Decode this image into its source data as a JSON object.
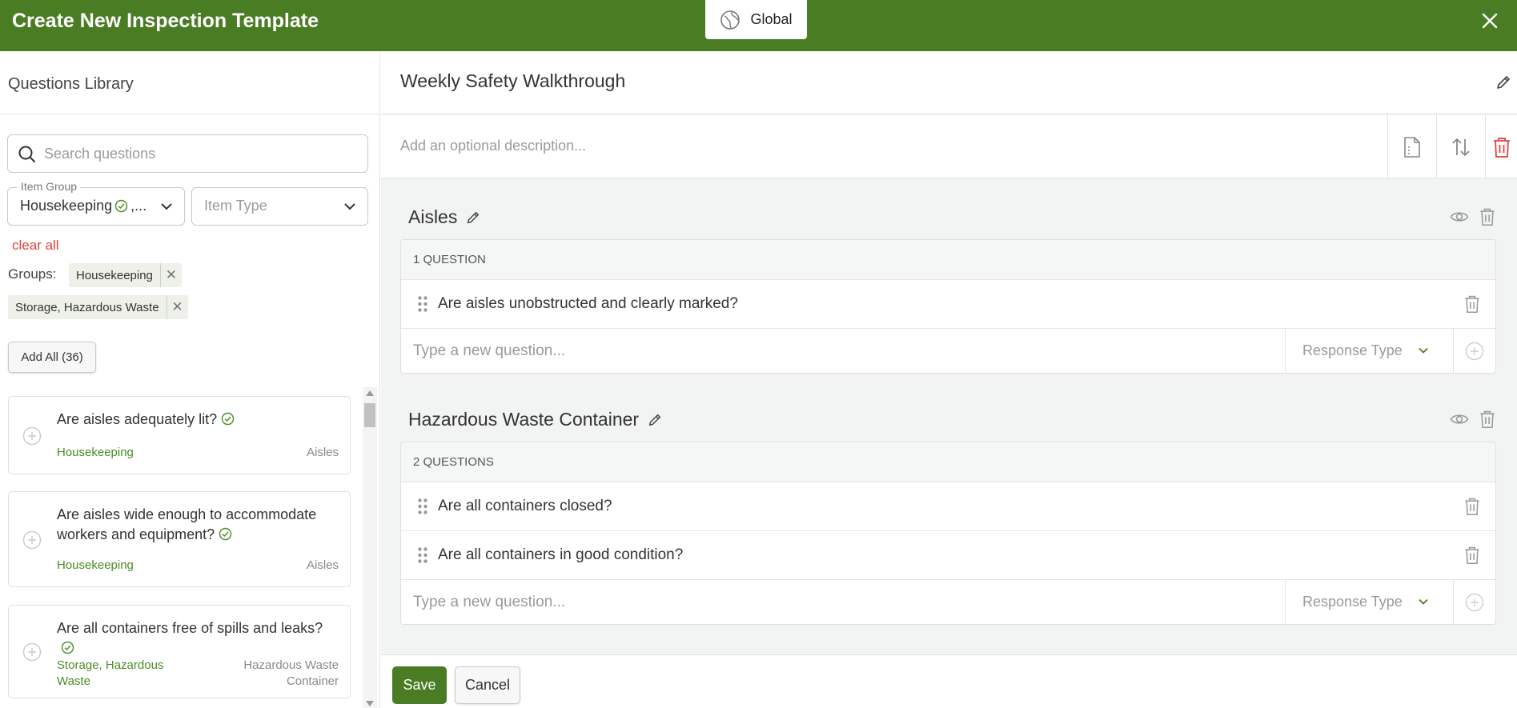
{
  "header": {
    "title": "Create New Inspection Template",
    "scope_label": "Global",
    "brand_color": "#4a7c24"
  },
  "library": {
    "title": "Questions Library",
    "search_placeholder": "Search questions",
    "item_group": {
      "legend": "Item Group",
      "value": "Housekeeping",
      "overflow": ",..."
    },
    "item_type": {
      "placeholder": "Item Type"
    },
    "clear_all": "clear all",
    "groups_label": "Groups:",
    "group_chips": [
      {
        "label": "Housekeeping"
      },
      {
        "label": "Storage, Hazardous Waste"
      }
    ],
    "add_all": "Add All (36)",
    "questions": [
      {
        "text": "Are aisles adequately lit?",
        "group": "Housekeeping",
        "category": "Aisles"
      },
      {
        "text": "Are aisles wide enough to accommodate workers and equipment?",
        "group": "Housekeeping",
        "category": "Aisles"
      },
      {
        "text": "Are all containers free of spills and leaks?",
        "group": "Storage, Hazardous Waste",
        "category": "Hazardous Waste Container"
      }
    ]
  },
  "template": {
    "title": "Weekly Safety Walkthrough",
    "description_placeholder": "Add an optional description...",
    "sections": [
      {
        "name": "Aisles",
        "count_label": "1 QUESTION",
        "questions": [
          "Are aisles unobstructed and clearly marked?"
        ],
        "new_question_placeholder": "Type a new question...",
        "response_type_placeholder": "Response Type"
      },
      {
        "name": "Hazardous Waste Container",
        "count_label": "2 QUESTIONS",
        "questions": [
          "Are all containers closed?",
          "Are all containers in good condition?"
        ],
        "new_question_placeholder": "Type a new question...",
        "response_type_placeholder": "Response Type"
      }
    ]
  },
  "footer": {
    "save_label": "Save",
    "cancel_label": "Cancel"
  }
}
